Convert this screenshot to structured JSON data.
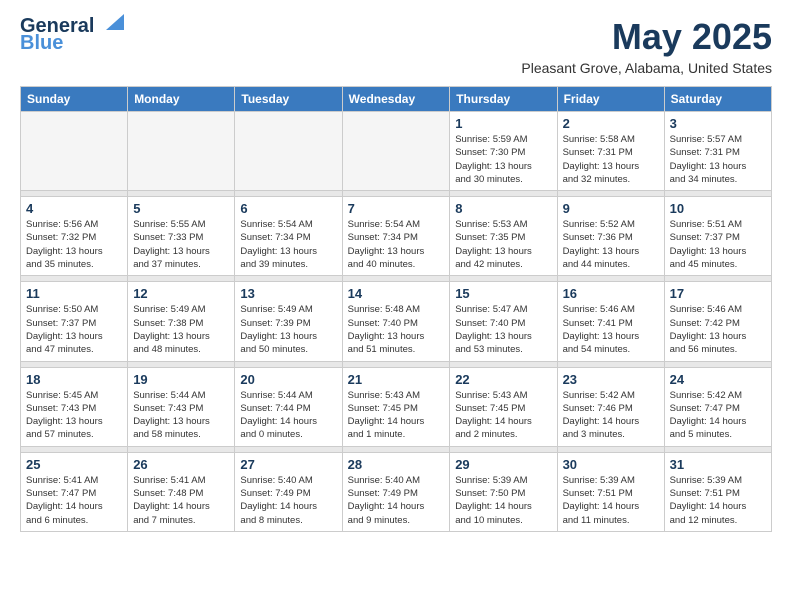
{
  "logo": {
    "line1": "General",
    "line2": "Blue"
  },
  "title": "May 2025",
  "location": "Pleasant Grove, Alabama, United States",
  "days_header": [
    "Sunday",
    "Monday",
    "Tuesday",
    "Wednesday",
    "Thursday",
    "Friday",
    "Saturday"
  ],
  "weeks": [
    [
      {
        "num": "",
        "info": ""
      },
      {
        "num": "",
        "info": ""
      },
      {
        "num": "",
        "info": ""
      },
      {
        "num": "",
        "info": ""
      },
      {
        "num": "1",
        "info": "Sunrise: 5:59 AM\nSunset: 7:30 PM\nDaylight: 13 hours\nand 30 minutes."
      },
      {
        "num": "2",
        "info": "Sunrise: 5:58 AM\nSunset: 7:31 PM\nDaylight: 13 hours\nand 32 minutes."
      },
      {
        "num": "3",
        "info": "Sunrise: 5:57 AM\nSunset: 7:31 PM\nDaylight: 13 hours\nand 34 minutes."
      }
    ],
    [
      {
        "num": "4",
        "info": "Sunrise: 5:56 AM\nSunset: 7:32 PM\nDaylight: 13 hours\nand 35 minutes."
      },
      {
        "num": "5",
        "info": "Sunrise: 5:55 AM\nSunset: 7:33 PM\nDaylight: 13 hours\nand 37 minutes."
      },
      {
        "num": "6",
        "info": "Sunrise: 5:54 AM\nSunset: 7:34 PM\nDaylight: 13 hours\nand 39 minutes."
      },
      {
        "num": "7",
        "info": "Sunrise: 5:54 AM\nSunset: 7:34 PM\nDaylight: 13 hours\nand 40 minutes."
      },
      {
        "num": "8",
        "info": "Sunrise: 5:53 AM\nSunset: 7:35 PM\nDaylight: 13 hours\nand 42 minutes."
      },
      {
        "num": "9",
        "info": "Sunrise: 5:52 AM\nSunset: 7:36 PM\nDaylight: 13 hours\nand 44 minutes."
      },
      {
        "num": "10",
        "info": "Sunrise: 5:51 AM\nSunset: 7:37 PM\nDaylight: 13 hours\nand 45 minutes."
      }
    ],
    [
      {
        "num": "11",
        "info": "Sunrise: 5:50 AM\nSunset: 7:37 PM\nDaylight: 13 hours\nand 47 minutes."
      },
      {
        "num": "12",
        "info": "Sunrise: 5:49 AM\nSunset: 7:38 PM\nDaylight: 13 hours\nand 48 minutes."
      },
      {
        "num": "13",
        "info": "Sunrise: 5:49 AM\nSunset: 7:39 PM\nDaylight: 13 hours\nand 50 minutes."
      },
      {
        "num": "14",
        "info": "Sunrise: 5:48 AM\nSunset: 7:40 PM\nDaylight: 13 hours\nand 51 minutes."
      },
      {
        "num": "15",
        "info": "Sunrise: 5:47 AM\nSunset: 7:40 PM\nDaylight: 13 hours\nand 53 minutes."
      },
      {
        "num": "16",
        "info": "Sunrise: 5:46 AM\nSunset: 7:41 PM\nDaylight: 13 hours\nand 54 minutes."
      },
      {
        "num": "17",
        "info": "Sunrise: 5:46 AM\nSunset: 7:42 PM\nDaylight: 13 hours\nand 56 minutes."
      }
    ],
    [
      {
        "num": "18",
        "info": "Sunrise: 5:45 AM\nSunset: 7:43 PM\nDaylight: 13 hours\nand 57 minutes."
      },
      {
        "num": "19",
        "info": "Sunrise: 5:44 AM\nSunset: 7:43 PM\nDaylight: 13 hours\nand 58 minutes."
      },
      {
        "num": "20",
        "info": "Sunrise: 5:44 AM\nSunset: 7:44 PM\nDaylight: 14 hours\nand 0 minutes."
      },
      {
        "num": "21",
        "info": "Sunrise: 5:43 AM\nSunset: 7:45 PM\nDaylight: 14 hours\nand 1 minute."
      },
      {
        "num": "22",
        "info": "Sunrise: 5:43 AM\nSunset: 7:45 PM\nDaylight: 14 hours\nand 2 minutes."
      },
      {
        "num": "23",
        "info": "Sunrise: 5:42 AM\nSunset: 7:46 PM\nDaylight: 14 hours\nand 3 minutes."
      },
      {
        "num": "24",
        "info": "Sunrise: 5:42 AM\nSunset: 7:47 PM\nDaylight: 14 hours\nand 5 minutes."
      }
    ],
    [
      {
        "num": "25",
        "info": "Sunrise: 5:41 AM\nSunset: 7:47 PM\nDaylight: 14 hours\nand 6 minutes."
      },
      {
        "num": "26",
        "info": "Sunrise: 5:41 AM\nSunset: 7:48 PM\nDaylight: 14 hours\nand 7 minutes."
      },
      {
        "num": "27",
        "info": "Sunrise: 5:40 AM\nSunset: 7:49 PM\nDaylight: 14 hours\nand 8 minutes."
      },
      {
        "num": "28",
        "info": "Sunrise: 5:40 AM\nSunset: 7:49 PM\nDaylight: 14 hours\nand 9 minutes."
      },
      {
        "num": "29",
        "info": "Sunrise: 5:39 AM\nSunset: 7:50 PM\nDaylight: 14 hours\nand 10 minutes."
      },
      {
        "num": "30",
        "info": "Sunrise: 5:39 AM\nSunset: 7:51 PM\nDaylight: 14 hours\nand 11 minutes."
      },
      {
        "num": "31",
        "info": "Sunrise: 5:39 AM\nSunset: 7:51 PM\nDaylight: 14 hours\nand 12 minutes."
      }
    ]
  ]
}
